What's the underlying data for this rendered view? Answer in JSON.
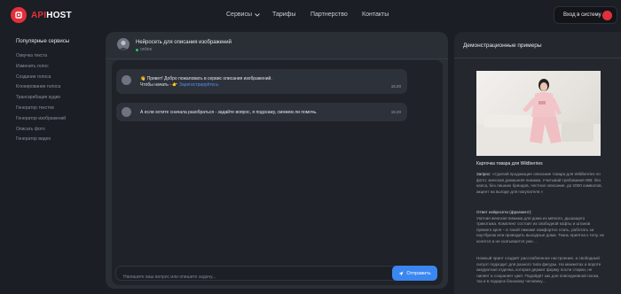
{
  "header": {
    "logo_prefix": "API",
    "logo_suffix": "HOST",
    "nav": [
      {
        "label": "Сервисы"
      },
      {
        "label": "Тарифы"
      },
      {
        "label": "Партнерство"
      },
      {
        "label": "Контакты"
      }
    ],
    "login_label": "Вход в систему"
  },
  "sidebar": {
    "title": "Популярные сервисы",
    "items": [
      "Озвучка текста",
      "Изменить голос",
      "Создание голоса",
      "Клонирование голоса",
      "Транскрибация аудио",
      "Генератор текстов",
      "Генератор изображений",
      "Описать фото",
      "Генератор видео"
    ]
  },
  "chat": {
    "title": "Нейросеть для описания изображений",
    "status": "online",
    "messages": [
      {
        "line1": "👋 Привет! Добро пожаловать в сервис описания изображений.",
        "line2": "Чтобы начать - 👉",
        "link": "Зарегистрируйтесь",
        "time": "15:20"
      },
      {
        "line1": "А если хотите сначала разобраться - задайте вопрос, я подскажу, сможем ли помочь.",
        "time": "15:20"
      }
    ],
    "input_placeholder": "Напишите ваш вопрос или опишите задачу...",
    "send_label": "Отправить"
  },
  "examples": {
    "title": "Демонстрационные примеры",
    "caption": "Карточка товара для Wildberries",
    "request_label": "Запрос:",
    "request_text": "«Сделай продающее описание товара для Wildberries по фото: женская домашняя пижама. Учитывай требования WB: без капса, без лишних брендов, честное описание, до 2000 символов, акцент на выгоде для покупателя.»",
    "answer_label": "Ответ нейросети (фрагмент):",
    "answer_text": "Уютная женская пижама для дома из мягкого, дышащего трикотажа. Комплект состоит из свободной кофты и штанов прямого кроя – в такой пижаме комфортно спать, работать за ноутбуком или проводить выходные дома. Ткань приятна к телу, не колется и не скатывается уже…",
    "answer_text2": "Нежный принт создаёт расслабленное настроение, а свободный силуэт подходит для разного типа фигуры. На манжетах и вороте аккуратная отделка, которая держит форму после стирки, не линяет и сохраняет цвет. Подойдёт как для повседневной носки, так и в подарок близкому человеку…"
  },
  "colors": {
    "accent": "#e2303b",
    "link": "#4f8ff7",
    "send": "#3a87f2",
    "online": "#31c26b"
  }
}
